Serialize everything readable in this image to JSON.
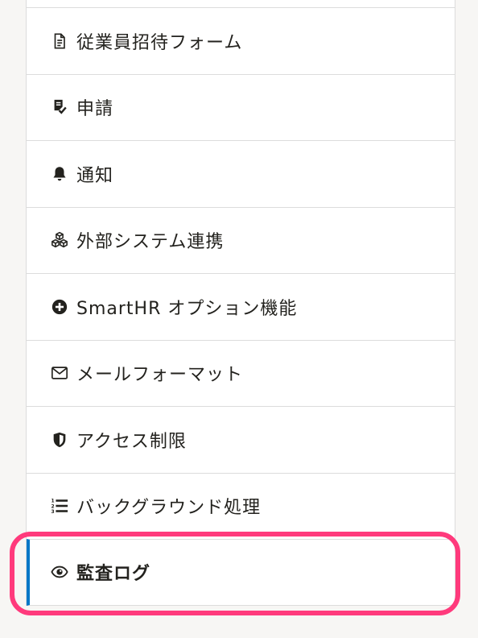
{
  "menu": {
    "items": [
      {
        "label": "",
        "icon": "none"
      },
      {
        "label": "従業員招待フォーム",
        "icon": "document-icon"
      },
      {
        "label": "申請",
        "icon": "request-check-icon"
      },
      {
        "label": "通知",
        "icon": "bell-icon"
      },
      {
        "label": "外部システム連携",
        "icon": "cubes-icon"
      },
      {
        "label": "SmartHR オプション機能",
        "icon": "plus-circle-icon"
      },
      {
        "label": "メールフォーマット",
        "icon": "envelope-icon"
      },
      {
        "label": "アクセス制限",
        "icon": "shield-icon"
      },
      {
        "label": "バックグラウンド処理",
        "icon": "numbered-list-icon"
      },
      {
        "label": "監査ログ",
        "icon": "eye-icon",
        "active": true
      }
    ]
  },
  "colors": {
    "active_indicator": "#0077c7",
    "highlight_ring": "#ff3a7c",
    "text": "#23221e",
    "border": "#dcdcdc",
    "background": "#f7f6f4"
  }
}
